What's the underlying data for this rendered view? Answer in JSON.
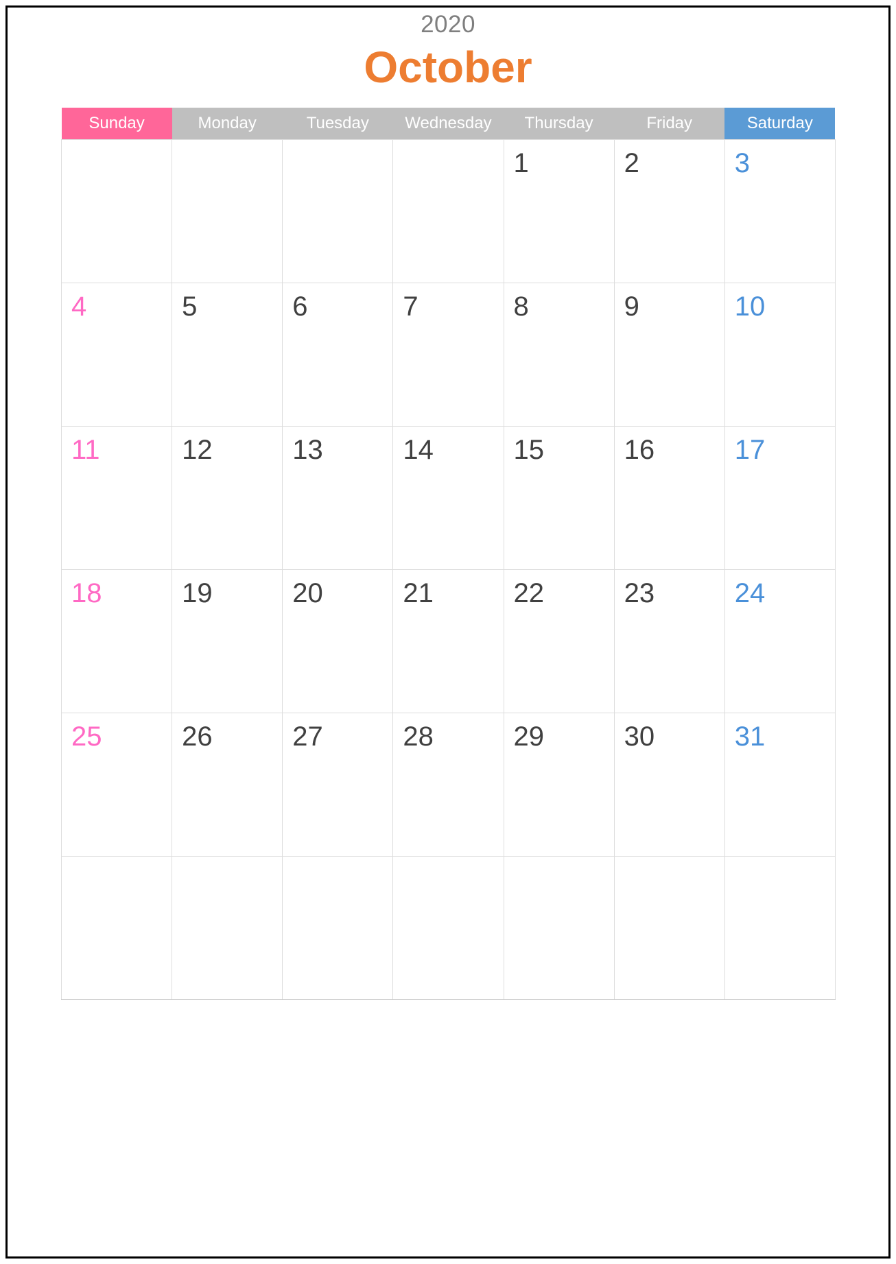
{
  "header": {
    "year": "2020",
    "month": "October",
    "year_color": "#7f7f7f",
    "month_color": "#ed7d31"
  },
  "colors": {
    "sunday_header_bg": "#ff6699",
    "weekday_header_bg": "#bfbfbf",
    "saturday_header_bg": "#5b9bd5",
    "header_text": "#ffffff",
    "sunday_date": "#ff69c4",
    "saturday_date": "#4a90d9",
    "weekday_date": "#404040",
    "grid_line": "#dddddd",
    "page_border": "#000000",
    "page_background": "#ffffff"
  },
  "weekdays": [
    {
      "label": "Sunday",
      "kind": "sunday"
    },
    {
      "label": "Monday",
      "kind": "weekday"
    },
    {
      "label": "Tuesday",
      "kind": "weekday"
    },
    {
      "label": "Wednesday",
      "kind": "weekday"
    },
    {
      "label": "Thursday",
      "kind": "weekday"
    },
    {
      "label": "Friday",
      "kind": "weekday"
    },
    {
      "label": "Saturday",
      "kind": "saturday"
    }
  ],
  "weeks": [
    [
      {
        "day": ""
      },
      {
        "day": ""
      },
      {
        "day": ""
      },
      {
        "day": ""
      },
      {
        "day": "1"
      },
      {
        "day": "2"
      },
      {
        "day": "3"
      }
    ],
    [
      {
        "day": "4"
      },
      {
        "day": "5"
      },
      {
        "day": "6"
      },
      {
        "day": "7"
      },
      {
        "day": "8"
      },
      {
        "day": "9"
      },
      {
        "day": "10"
      }
    ],
    [
      {
        "day": "11"
      },
      {
        "day": "12"
      },
      {
        "day": "13"
      },
      {
        "day": "14"
      },
      {
        "day": "15"
      },
      {
        "day": "16"
      },
      {
        "day": "17"
      }
    ],
    [
      {
        "day": "18"
      },
      {
        "day": "19"
      },
      {
        "day": "20"
      },
      {
        "day": "21"
      },
      {
        "day": "22"
      },
      {
        "day": "23"
      },
      {
        "day": "24"
      }
    ],
    [
      {
        "day": "25"
      },
      {
        "day": "26"
      },
      {
        "day": "27"
      },
      {
        "day": "28"
      },
      {
        "day": "29"
      },
      {
        "day": "30"
      },
      {
        "day": "31"
      }
    ],
    [
      {
        "day": ""
      },
      {
        "day": ""
      },
      {
        "day": ""
      },
      {
        "day": ""
      },
      {
        "day": ""
      },
      {
        "day": ""
      },
      {
        "day": ""
      }
    ]
  ]
}
